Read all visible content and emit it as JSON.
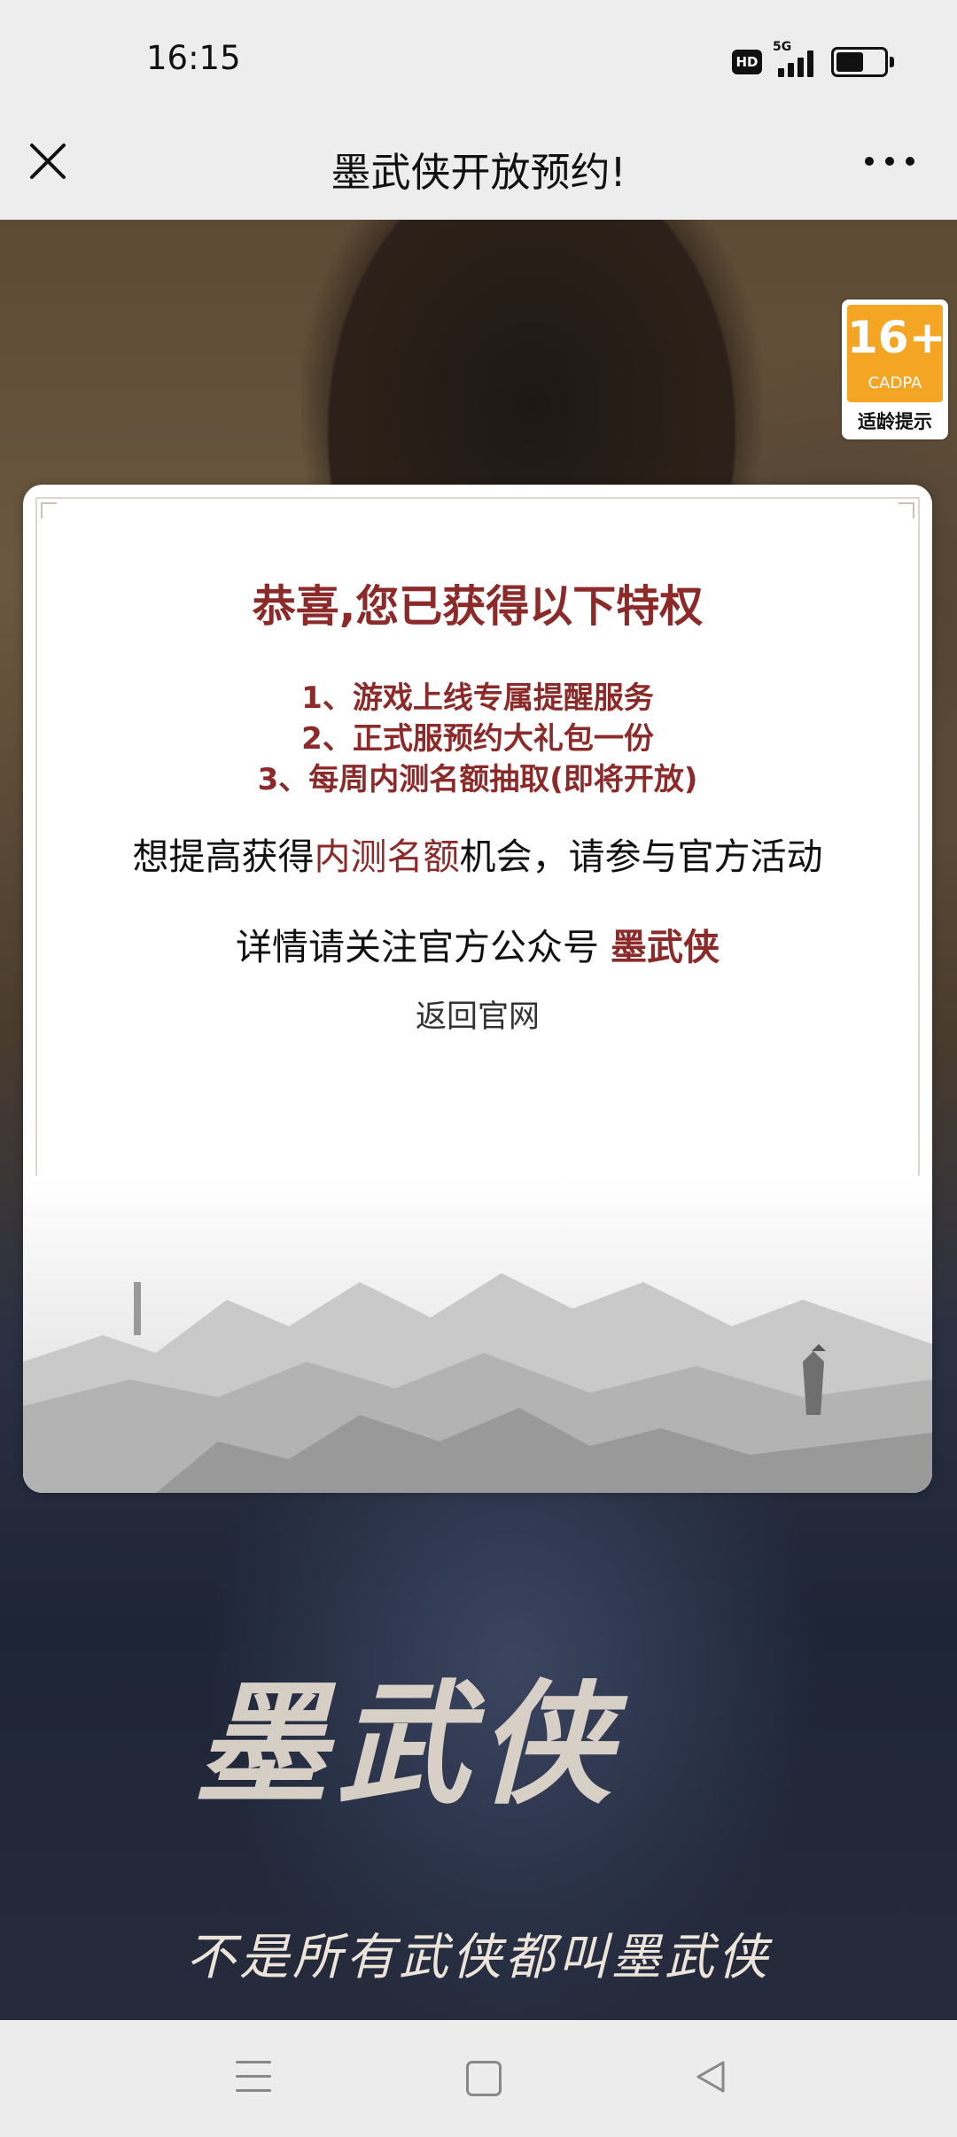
{
  "status_bar": {
    "time": "16:15",
    "hd_label": "HD",
    "network": "5G",
    "icons": [
      "hd-icon",
      "signal-icon",
      "battery-icon"
    ]
  },
  "nav": {
    "title": "墨武侠开放预约!",
    "close_icon": "close-icon",
    "more_icon": "more-icon"
  },
  "age_badge": {
    "rating": "16+",
    "org": "CADPA",
    "label": "适龄提示",
    "color": "#f5a524"
  },
  "modal": {
    "title": "恭喜,您已获得以下特权",
    "privileges": [
      "1、游戏上线专属提醒服务",
      "2、正式服预约大礼包一份",
      "3、每周内测名额抽取(即将开放)"
    ],
    "promo_prefix": "想提高获得",
    "promo_highlight": "内测名额",
    "promo_suffix": "机会，请参与官方活动",
    "follow_text": "详情请关注官方公众号 ",
    "follow_account": "墨武侠",
    "back_link": "返回官网",
    "accent_color": "#8c2a2a"
  },
  "hero": {
    "logo_text": "墨武侠",
    "slogan": "不是所有武侠都叫墨武侠"
  },
  "system_nav": {
    "icons": [
      "menu-icon",
      "home-icon",
      "back-icon"
    ]
  }
}
